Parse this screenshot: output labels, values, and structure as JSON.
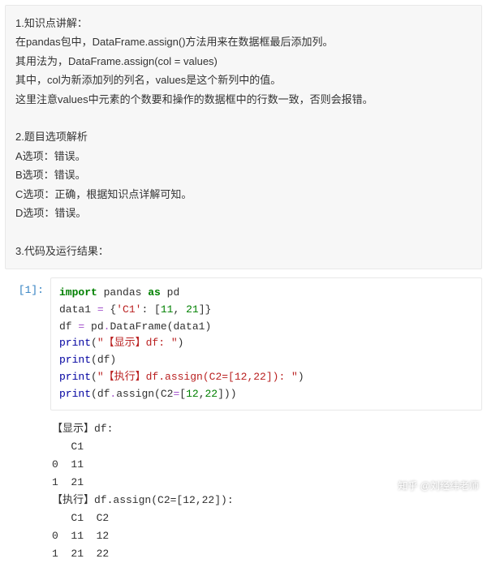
{
  "markdown": {
    "lines": [
      "1.知识点讲解：",
      "在pandas包中，DataFrame.assign()方法用来在数据框最后添加列。",
      "其用法为，DataFrame.assign(col = values)",
      "其中，col为新添加列的列名，values是这个新列中的值。",
      "这里注意values中元素的个数要和操作的数据框中的行数一致，否则会报错。",
      "",
      "2.题目选项解析",
      "A选项：错误。",
      "B选项：错误。",
      "C选项：正确，根据知识点详解可知。",
      "D选项：错误。",
      "",
      "3.代码及运行结果："
    ]
  },
  "prompt": "[1]:",
  "code": {
    "t_import": "import",
    "t_pandas": " pandas ",
    "t_as": "as",
    "t_pd": " pd",
    "l2_a": "data1 ",
    "l2_eq": "=",
    "l2_b": " {",
    "l2_key": "'C1'",
    "l2_c": ": [",
    "l2_n1": "11",
    "l2_d": ", ",
    "l2_n2": "21",
    "l2_e": "]}",
    "l3_a": "df ",
    "l3_eq": "=",
    "l3_b": " pd",
    "l3_dot": ".",
    "l3_df": "DataFrame",
    "l3_c": "(data1)",
    "l4_p": "print",
    "l4_a": "(",
    "l4_s": "\"【显示】df: \"",
    "l4_b": ")",
    "l5_p": "print",
    "l5_a": "(df)",
    "l6_p": "print",
    "l6_a": "(",
    "l6_s": "\"【执行】df.assign(C2=[12,22]): \"",
    "l6_b": ")",
    "l7_p": "print",
    "l7_a": "(df",
    "l7_dot": ".",
    "l7_m": "assign",
    "l7_b": "(C2",
    "l7_eq": "=",
    "l7_c": "[",
    "l7_n1": "12",
    "l7_d": ",",
    "l7_n2": "22",
    "l7_e": "]))"
  },
  "output": "【显示】df: \n   C1\n0  11\n1  21\n【执行】df.assign(C2=[12,22]): \n   C1  C2\n0  11  12\n1  21  22",
  "watermark": "知乎 @刘经纬老师"
}
